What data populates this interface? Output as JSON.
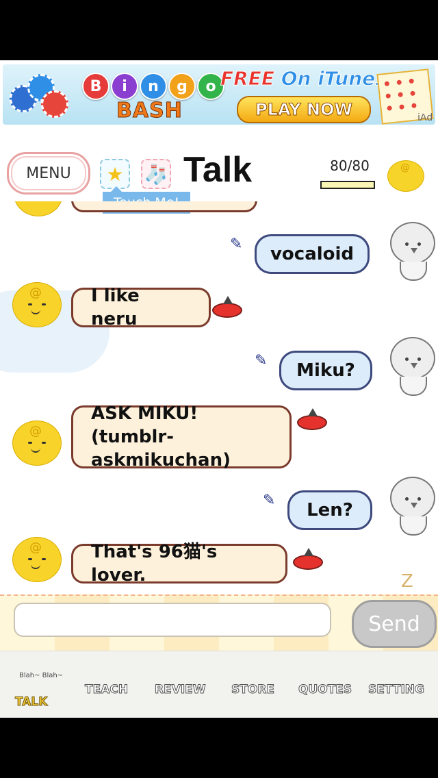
{
  "ad": {
    "bingo_letters": [
      "B",
      "i",
      "n",
      "g",
      "o"
    ],
    "bingo_colors": [
      "#e53b3b",
      "#8b3fd1",
      "#2f8ee6",
      "#f2a11b",
      "#33b44a"
    ],
    "bash": "BASH",
    "free_word": "FREE",
    "on_itunes": "On iTunes",
    "play_now": "PLAY NOW",
    "iad": "iAd"
  },
  "header": {
    "menu_label": "MENU",
    "title": "Talk",
    "score": "80/80",
    "touch_tip": "Touch Me!",
    "star_icon": "★",
    "sock_icon": "🧦"
  },
  "messages": [
    {
      "from": "user",
      "text": "vocaloid"
    },
    {
      "from": "simi",
      "text": "I like neru"
    },
    {
      "from": "user",
      "text": "Miku?"
    },
    {
      "from": "simi",
      "line1": "ASK MIKU! (tumblr-",
      "line2": "askmikuchan)"
    },
    {
      "from": "user",
      "text": "Len?"
    },
    {
      "from": "simi",
      "text": "That's 96猫's lover."
    }
  ],
  "input": {
    "placeholder": "",
    "send_label": "Send",
    "sleep_mark": "Z"
  },
  "tabs": [
    {
      "label": "TALK",
      "active": true,
      "decoration": "Blah~ Blah~"
    },
    {
      "label": "TEACH"
    },
    {
      "label": "REVIEW"
    },
    {
      "label": "STORE"
    },
    {
      "label": "QUOTES"
    },
    {
      "label": "SETTING"
    }
  ],
  "colors": {
    "simi_yellow": "#f8d32a",
    "simi_bubble": "#fdf1db",
    "user_bubble": "#dcecfb",
    "send_gray": "#c8c8c8"
  }
}
